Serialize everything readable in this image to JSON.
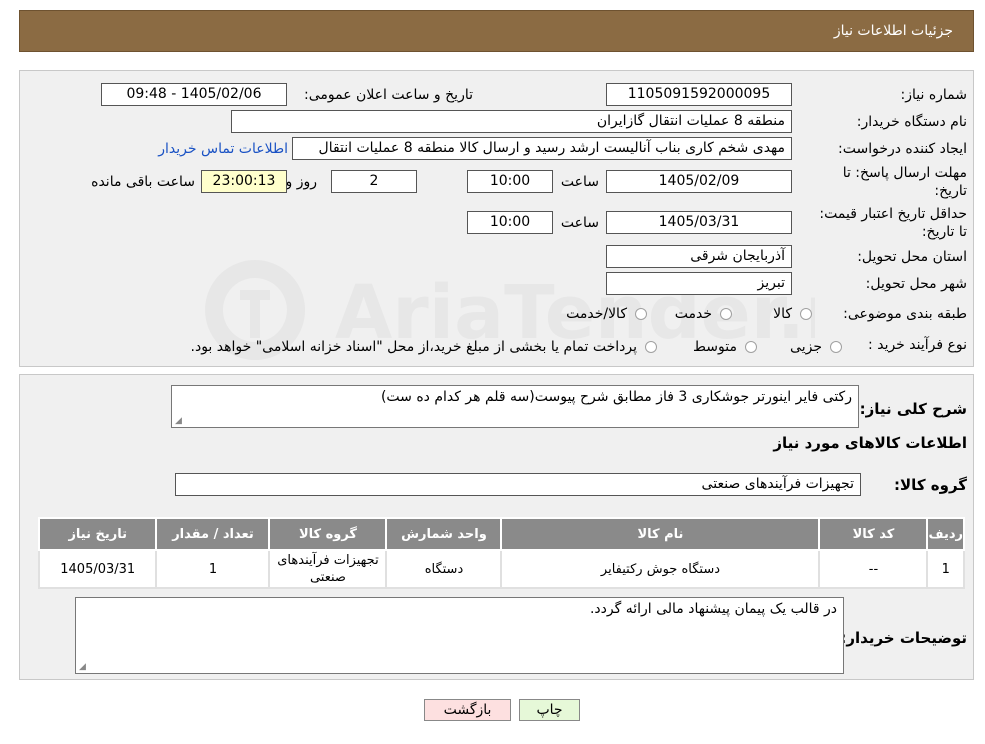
{
  "header": {
    "title": "جزئیات اطلاعات نیاز"
  },
  "form": {
    "need_number_label": "شماره نیاز:",
    "need_number": "1105091592000095",
    "announce_label": "تاریخ و ساعت اعلان عمومی:",
    "announce_value": "1405/02/06 - 09:48",
    "buyer_org_label": "نام دستگاه خریدار:",
    "buyer_org": "منطقه 8 عملیات انتقال گازایران",
    "creator_label": "ایجاد کننده درخواست:",
    "creator": "مهدی شخم کاری بناب آنالیست ارشد رسید و ارسال کالا منطقه 8 عملیات انتقال",
    "contact_link": "اطلاعات تماس خریدار",
    "reply_deadline_label": "مهلت ارسال پاسخ: تا تاریخ:",
    "reply_date": "1405/02/09",
    "time_label": "ساعت",
    "reply_time": "10:00",
    "days_value": "2",
    "days_label": "روز و",
    "remaining_value": "23:00:13",
    "remaining_label": "ساعت باقی مانده",
    "validity_label": "حداقل تاریخ اعتبار قیمت: تا تاریخ:",
    "validity_date": "1405/03/31",
    "validity_time": "10:00",
    "province_label": "استان محل تحویل:",
    "province": "آذربایجان شرقی",
    "city_label": "شهر محل تحویل:",
    "city": "تبریز",
    "category_label": "طبقه بندی موضوعی:",
    "category_options": [
      "کالا",
      "خدمت",
      "کالا/خدمت"
    ],
    "process_label": "نوع فرآیند خرید :",
    "process_options": [
      "جزیی",
      "متوسط"
    ],
    "process_note": "پرداخت تمام یا بخشی از مبلغ خرید،از محل \"اسناد خزانه اسلامی\" خواهد بود."
  },
  "summary": {
    "desc_label": "شرح کلی نیاز:",
    "desc_value": "رکتی فایر اینورتر جوشکاری 3 فاز مطابق شرح پیوست(سه قلم هر کدام ده ست)",
    "goods_info_title": "اطلاعات کالاهای مورد نیاز",
    "group_label": "گروه کالا:",
    "group_value": "تجهیزات فرآیندهای صنعتی"
  },
  "table": {
    "headers": [
      "ردیف",
      "کد کالا",
      "نام کالا",
      "واحد شمارش",
      "گروه کالا",
      "تعداد / مقدار",
      "تاریخ نیاز"
    ],
    "rows": [
      [
        "1",
        "--",
        "دستگاه جوش رکتیفایر",
        "دستگاه",
        "تجهیزات فرآیندهای صنعتی",
        "1",
        "1405/03/31"
      ]
    ]
  },
  "notes": {
    "label": "توضیحات خریدار:",
    "value": "در قالب یک پیمان پیشنهاد مالی ارائه گردد."
  },
  "buttons": {
    "print": "چاپ",
    "back": "بازگشت"
  },
  "colors": {
    "header_bg": "#8b6b43",
    "table_header_bg": "#8a8a8a",
    "print_btn": "#e6f8d8",
    "back_btn": "#fde0e0",
    "link": "#1a52c4"
  }
}
